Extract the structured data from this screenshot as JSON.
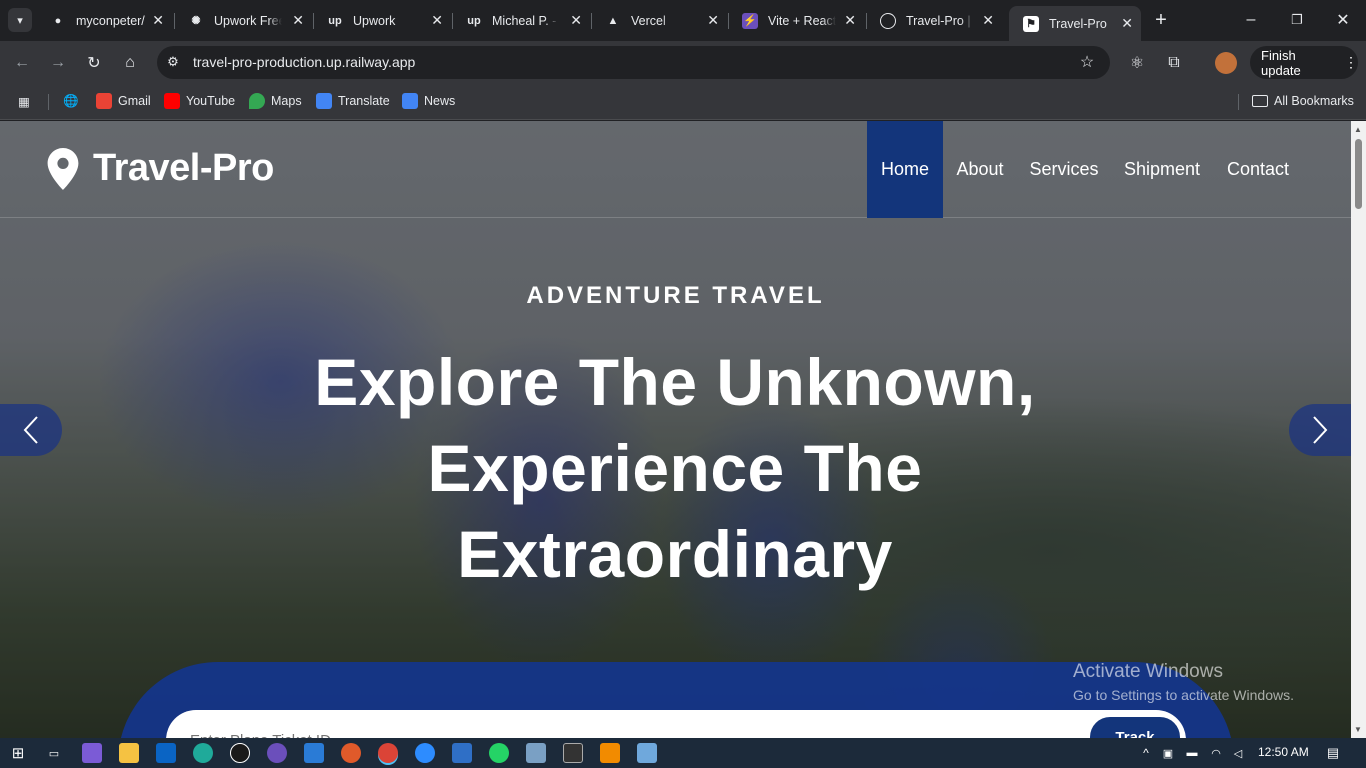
{
  "browser": {
    "tabs": [
      {
        "title": "myconpeter/",
        "icon": "github-icon"
      },
      {
        "title": "Upwork Free",
        "icon": "openai-icon"
      },
      {
        "title": "Upwork",
        "icon": "upwork-icon"
      },
      {
        "title": "Micheal P. - Upwork",
        "icon": "upwork-icon"
      },
      {
        "title": "Vercel",
        "icon": "vercel-icon"
      },
      {
        "title": "Vite + React",
        "icon": "vite-icon"
      },
      {
        "title": "Travel-Pro | Railway",
        "icon": "railway-icon"
      },
      {
        "title": "Travel-Pro",
        "icon": "location-pin-icon",
        "active": true
      }
    ],
    "url": "travel-pro-production.up.railway.app",
    "finish_update": "Finish update",
    "bookmarks": [
      {
        "label": "Gmail",
        "color": "#ea4335"
      },
      {
        "label": "YouTube",
        "color": "#ff0000"
      },
      {
        "label": "Maps",
        "color": "#34a853"
      },
      {
        "label": "Translate",
        "color": "#4285f4"
      },
      {
        "label": "News",
        "color": "#4285f4"
      }
    ],
    "all_bookmarks": "All Bookmarks"
  },
  "site": {
    "brand": "Travel-Pro",
    "nav": [
      {
        "label": "Home",
        "active": true
      },
      {
        "label": "About"
      },
      {
        "label": "Services"
      },
      {
        "label": "Shipment"
      },
      {
        "label": "Contact"
      }
    ],
    "hero": {
      "kicker": "ADVENTURE TRAVEL",
      "headline_lines": [
        "Explore The Unknown,",
        "Experience The",
        "Extraordinary"
      ]
    },
    "track": {
      "placeholder": "Enter Plane Ticket ID",
      "button": "Track"
    },
    "accent_color": "#13357b"
  },
  "watermark": {
    "line1": "Activate Windows",
    "line2": "Go to Settings to activate Windows."
  },
  "taskbar": {
    "time": "12:50 AM"
  }
}
